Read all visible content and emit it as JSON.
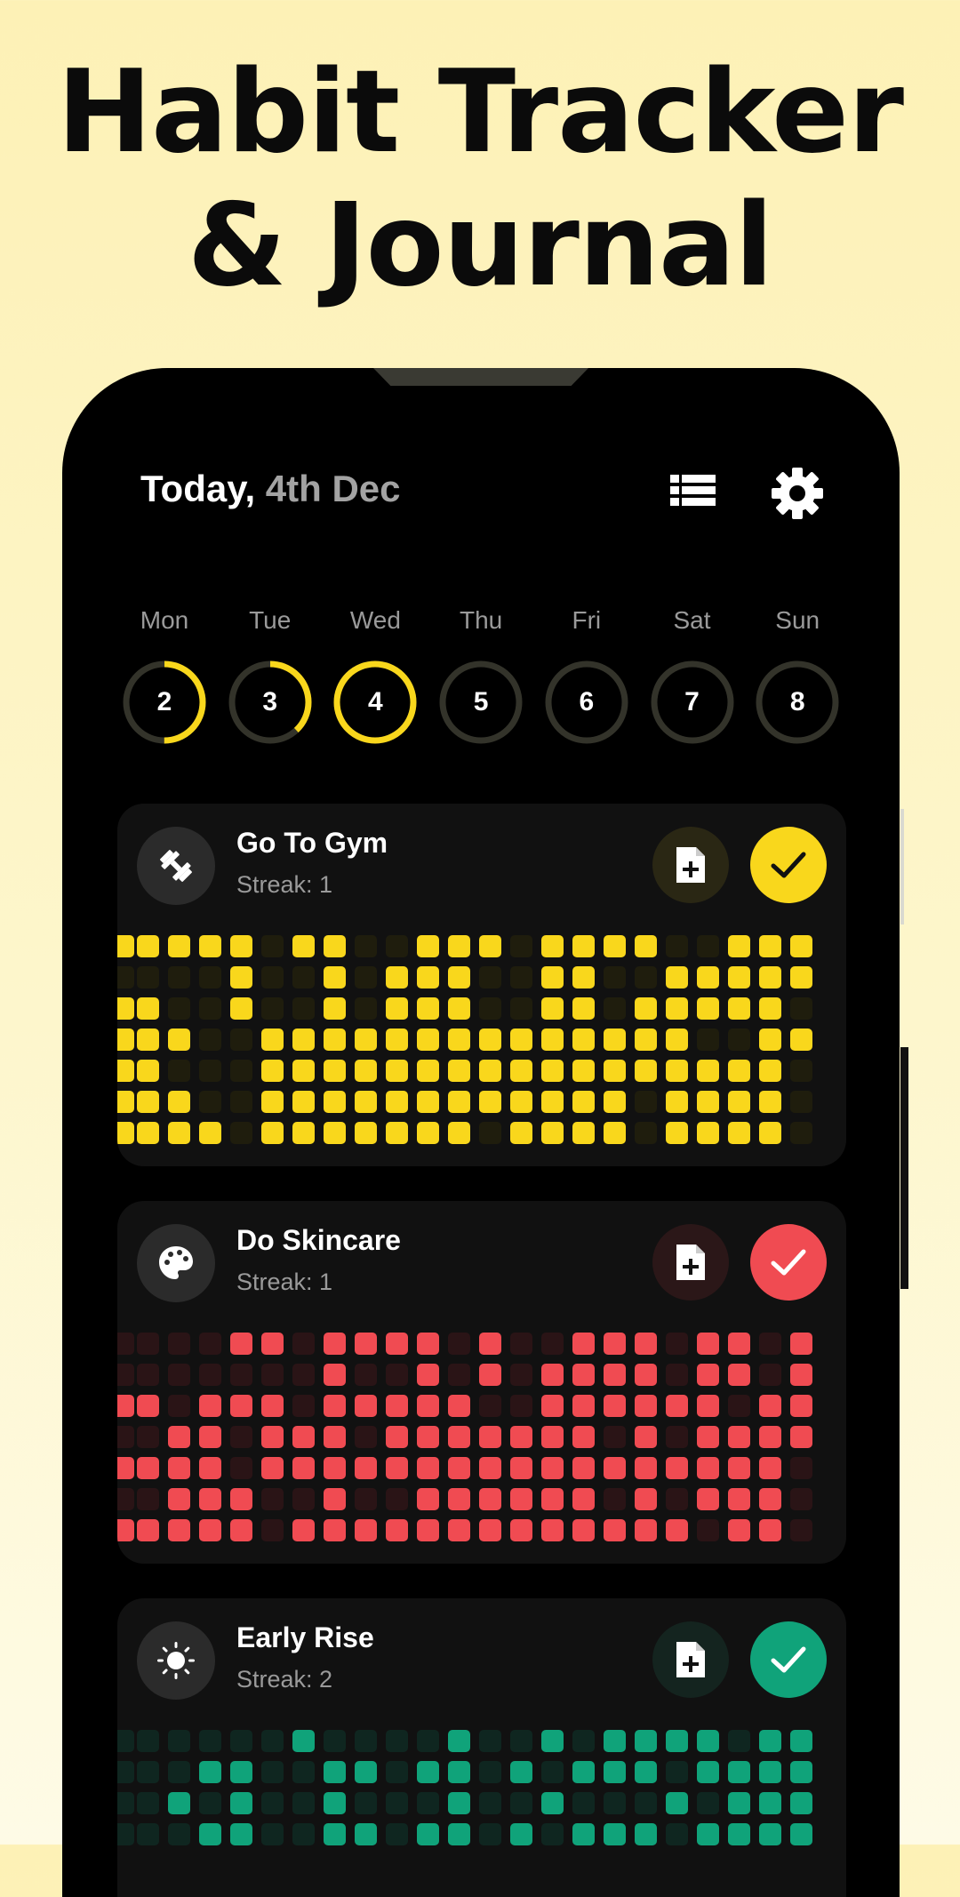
{
  "headline": {
    "line1": "Habit Tracker",
    "line2": "& Journal"
  },
  "header": {
    "today_label": "Today,",
    "date_label": "4th Dec",
    "list_icon": "list-icon",
    "settings_icon": "gear-icon"
  },
  "week": [
    {
      "name": "Mon",
      "num": "2",
      "progress": 0.5,
      "selected": false
    },
    {
      "name": "Tue",
      "num": "3",
      "progress": 0.38,
      "selected": false
    },
    {
      "name": "Wed",
      "num": "4",
      "progress": 1.0,
      "selected": true
    },
    {
      "name": "Thu",
      "num": "5",
      "progress": 0,
      "selected": false
    },
    {
      "name": "Fri",
      "num": "6",
      "progress": 0,
      "selected": false
    },
    {
      "name": "Sat",
      "num": "7",
      "progress": 0,
      "selected": false
    },
    {
      "name": "Sun",
      "num": "8",
      "progress": 0,
      "selected": false
    }
  ],
  "colors": {
    "ring_track": "#33332a",
    "ring_accent": "#f9d71c"
  },
  "habits": [
    {
      "title": "Go To Gym",
      "streak": "Streak: 1",
      "icon": "dumbbell-icon",
      "color": "#f9d71c",
      "dim": "#1f1d0d",
      "note_bg": "#2a2714",
      "check_fg": "#111111",
      "grid": [
        "1111011001110111100111",
        "0001001011100110011111",
        "1001001011100110111110",
        "1100111111111111110011",
        "1000111111111111111110",
        "1100111111111111011110",
        "1110111111101111011110"
      ]
    },
    {
      "title": "Do Skincare",
      "streak": "Streak: 1",
      "icon": "palette-icon",
      "color": "#f04b52",
      "dim": "#2a1416",
      "note_bg": "#2b1718",
      "check_fg": "#ffffff",
      "grid": [
        "0001101111010011101101",
        "0000001001010111101101",
        "1011101111100111111011",
        "0110111011111110101111",
        "1110111111111111111110",
        "0111001001111110101110",
        "1111011111111111110110"
      ]
    },
    {
      "title": "Early Rise",
      "streak": "Streak: 2",
      "icon": "sun-icon",
      "color": "#10a37a",
      "dim": "#0f2620",
      "note_bg": "#14241f",
      "check_fg": "#ffffff",
      "grid": [
        "0000010000100101111011",
        "0011001101101011101111",
        "0101001000100100010111",
        "0011001101101011101111"
      ]
    }
  ]
}
